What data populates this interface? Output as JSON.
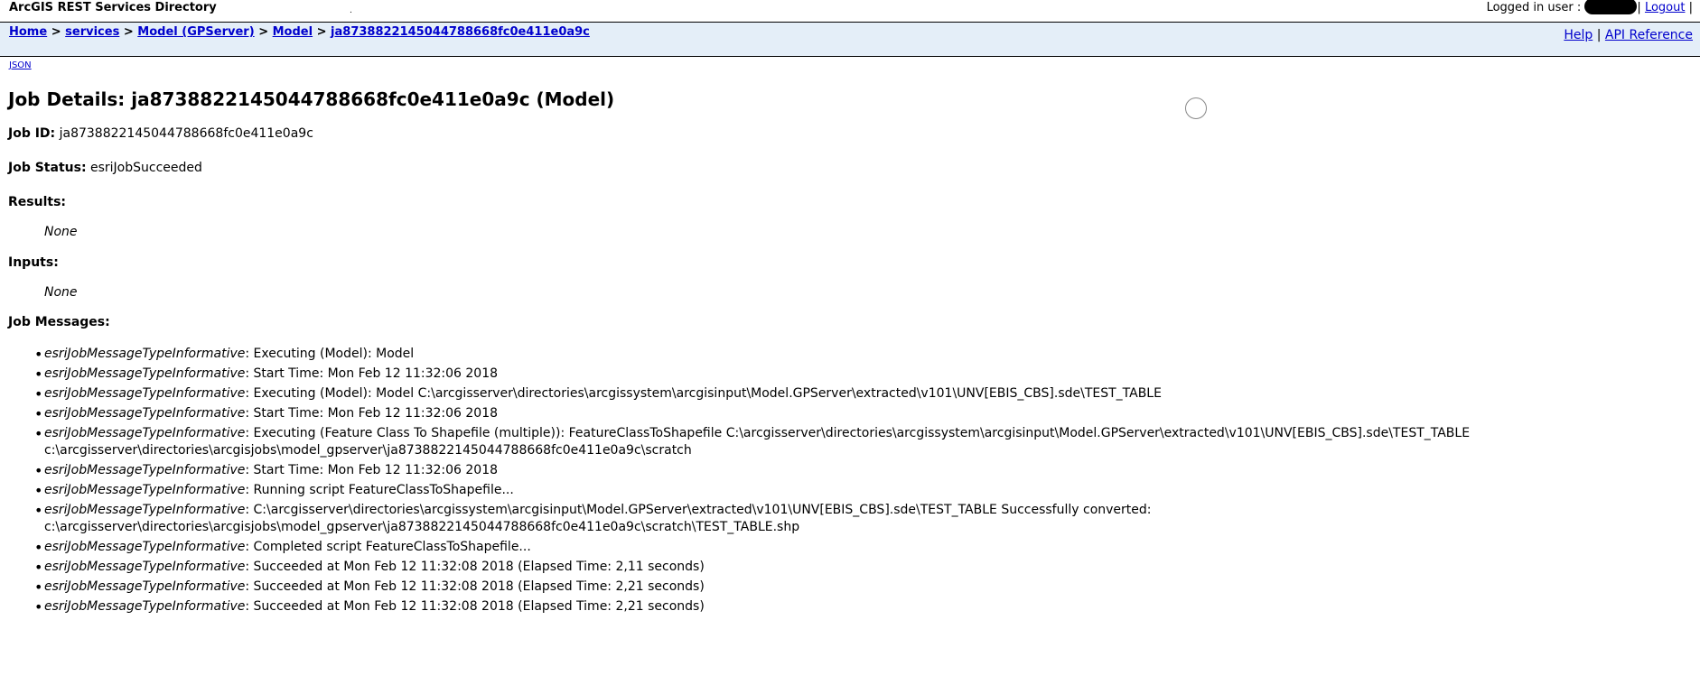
{
  "header": {
    "title": "ArcGIS REST Services Directory",
    "dot": ".",
    "logged_in_label": "Logged in user :",
    "logout_label": "Logout",
    "sep": "|"
  },
  "breadcrumb": {
    "items": [
      "Home",
      "services",
      "Model (GPServer)",
      "Model",
      "ja8738822145044788668fc0e411e0a9c"
    ],
    "separator": ">"
  },
  "nav": {
    "help": "Help",
    "api_reference": "API Reference",
    "sep": "|"
  },
  "json_link": "JSON",
  "page": {
    "title": "Job Details: ja8738822145044788668fc0e411e0a9c (Model)",
    "job_id_label": "Job ID:",
    "job_id": "ja8738822145044788668fc0e411e0a9c",
    "job_status_label": "Job Status:",
    "job_status": "esriJobSucceeded",
    "results_label": "Results:",
    "results_value": "None",
    "inputs_label": "Inputs:",
    "inputs_value": "None",
    "messages_label": "Job Messages:"
  },
  "messages": [
    {
      "type": "esriJobMessageTypeInformative",
      "text": ": Executing (Model): Model"
    },
    {
      "type": "esriJobMessageTypeInformative",
      "text": ": Start Time: Mon Feb 12 11:32:06 2018"
    },
    {
      "type": "esriJobMessageTypeInformative",
      "text": ": Executing (Model): Model C:\\arcgisserver\\directories\\arcgissystem\\arcgisinput\\Model.GPServer\\extracted\\v101\\UNV[EBIS_CBS].sde\\TEST_TABLE"
    },
    {
      "type": "esriJobMessageTypeInformative",
      "text": ": Start Time: Mon Feb 12 11:32:06 2018"
    },
    {
      "type": "esriJobMessageTypeInformative",
      "text": ": Executing (Feature Class To Shapefile (multiple)): FeatureClassToShapefile C:\\arcgisserver\\directories\\arcgissystem\\arcgisinput\\Model.GPServer\\extracted\\v101\\UNV[EBIS_CBS].sde\\TEST_TABLE c:\\arcgisserver\\directories\\arcgisjobs\\model_gpserver\\ja8738822145044788668fc0e411e0a9c\\scratch"
    },
    {
      "type": "esriJobMessageTypeInformative",
      "text": ": Start Time: Mon Feb 12 11:32:06 2018"
    },
    {
      "type": "esriJobMessageTypeInformative",
      "text": ": Running script FeatureClassToShapefile..."
    },
    {
      "type": "esriJobMessageTypeInformative",
      "text": ": C:\\arcgisserver\\directories\\arcgissystem\\arcgisinput\\Model.GPServer\\extracted\\v101\\UNV[EBIS_CBS].sde\\TEST_TABLE Successfully converted: c:\\arcgisserver\\directories\\arcgisjobs\\model_gpserver\\ja8738822145044788668fc0e411e0a9c\\scratch\\TEST_TABLE.shp"
    },
    {
      "type": "esriJobMessageTypeInformative",
      "text": ": Completed script FeatureClassToShapefile..."
    },
    {
      "type": "esriJobMessageTypeInformative",
      "text": ": Succeeded at Mon Feb 12 11:32:08 2018 (Elapsed Time: 2,11 seconds)"
    },
    {
      "type": "esriJobMessageTypeInformative",
      "text": ": Succeeded at Mon Feb 12 11:32:08 2018 (Elapsed Time: 2,21 seconds)"
    },
    {
      "type": "esriJobMessageTypeInformative",
      "text": ": Succeeded at Mon Feb 12 11:32:08 2018 (Elapsed Time: 2,21 seconds)"
    }
  ],
  "colors": {
    "link": "#0000cc",
    "nav_bg": "#e4eef8"
  }
}
